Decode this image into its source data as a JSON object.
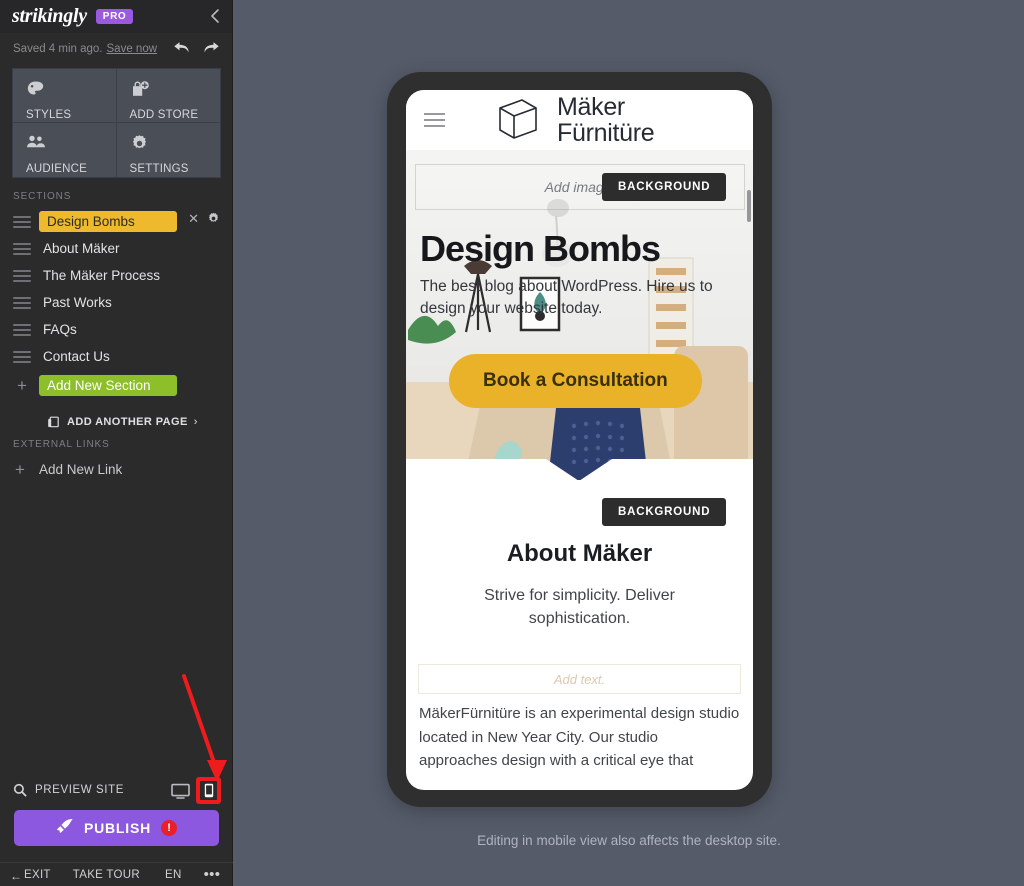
{
  "sidebar": {
    "logo": "strikingly",
    "pro_badge": "PRO",
    "collapse_icon": "chevron-left-icon",
    "save_status": "Saved 4 min ago.",
    "save_now": "Save now",
    "undo_icon": "undo-arrow-icon",
    "redo_icon": "redo-arrow-icon",
    "tools": [
      {
        "label": "STYLES",
        "icon": "palette-icon"
      },
      {
        "label": "ADD STORE",
        "icon": "store-add-icon"
      },
      {
        "label": "AUDIENCE",
        "icon": "audience-people-icon"
      },
      {
        "label": "SETTINGS",
        "icon": "gear-icon"
      }
    ],
    "sections_title": "SECTIONS",
    "sections": [
      {
        "label": "Design Bombs",
        "active": true
      },
      {
        "label": "About Mäker",
        "active": false
      },
      {
        "label": "The Mäker Process",
        "active": false
      },
      {
        "label": "Past Works",
        "active": false
      },
      {
        "label": "FAQs",
        "active": false
      },
      {
        "label": "Contact Us",
        "active": false
      }
    ],
    "section_remove_icon": "close-x-icon",
    "section_settings_icon": "gear-icon",
    "add_new_section": "Add New Section",
    "add_another_page": "ADD ANOTHER PAGE",
    "add_another_page_chevron": "›",
    "add_page_icon": "page-copy-icon",
    "external_links_title": "EXTERNAL LINKS",
    "add_new_link": "Add New Link",
    "preview_site": "PREVIEW SITE",
    "preview_icon": "magnifier-icon",
    "device_desktop_icon": "desktop-monitor-icon",
    "device_mobile_icon": "mobile-phone-icon",
    "publish_label": "PUBLISH",
    "publish_icon": "rocket-icon",
    "publish_alert": "!",
    "footer": {
      "exit": "EXIT",
      "exit_icon": "arrow-left-icon",
      "take_tour": "TAKE TOUR",
      "language": "EN",
      "more": "•••"
    },
    "colors": {
      "background": "#2b2b2b",
      "header": "#27272a",
      "pro_badge": "#9b59e0",
      "active_section": "#efb92e",
      "add_section": "#8cbf2a",
      "publish": "#8c58df",
      "alert": "#e8202a",
      "annotation": "#ee1c1c"
    }
  },
  "canvas": {
    "caption": "Editing in mobile view also affects the desktop site.",
    "background_color": "#555b69",
    "preview": {
      "nav": {
        "menu_icon": "hamburger-menu-icon",
        "logo_icon": "cube-logo-icon",
        "brand_line1": "Mäker",
        "brand_line2": "Fürnitüre"
      },
      "hero": {
        "add_image_placeholder": "Add image.",
        "background_button": "BACKGROUND",
        "title": "Design Bombs",
        "subtitle": "The best blog about WordPress. Hire us to design your website today.",
        "cta": "Book a Consultation",
        "cta_color": "#eab228"
      },
      "about": {
        "background_button": "BACKGROUND",
        "title": "About Mäker",
        "subtitle": "Strive for simplicity. Deliver sophistication.",
        "add_text_placeholder": "Add text.",
        "body": "MäkerFürnitüre is an experimental design studio located in New Year City. Our studio approaches design with a critical eye that"
      }
    }
  }
}
